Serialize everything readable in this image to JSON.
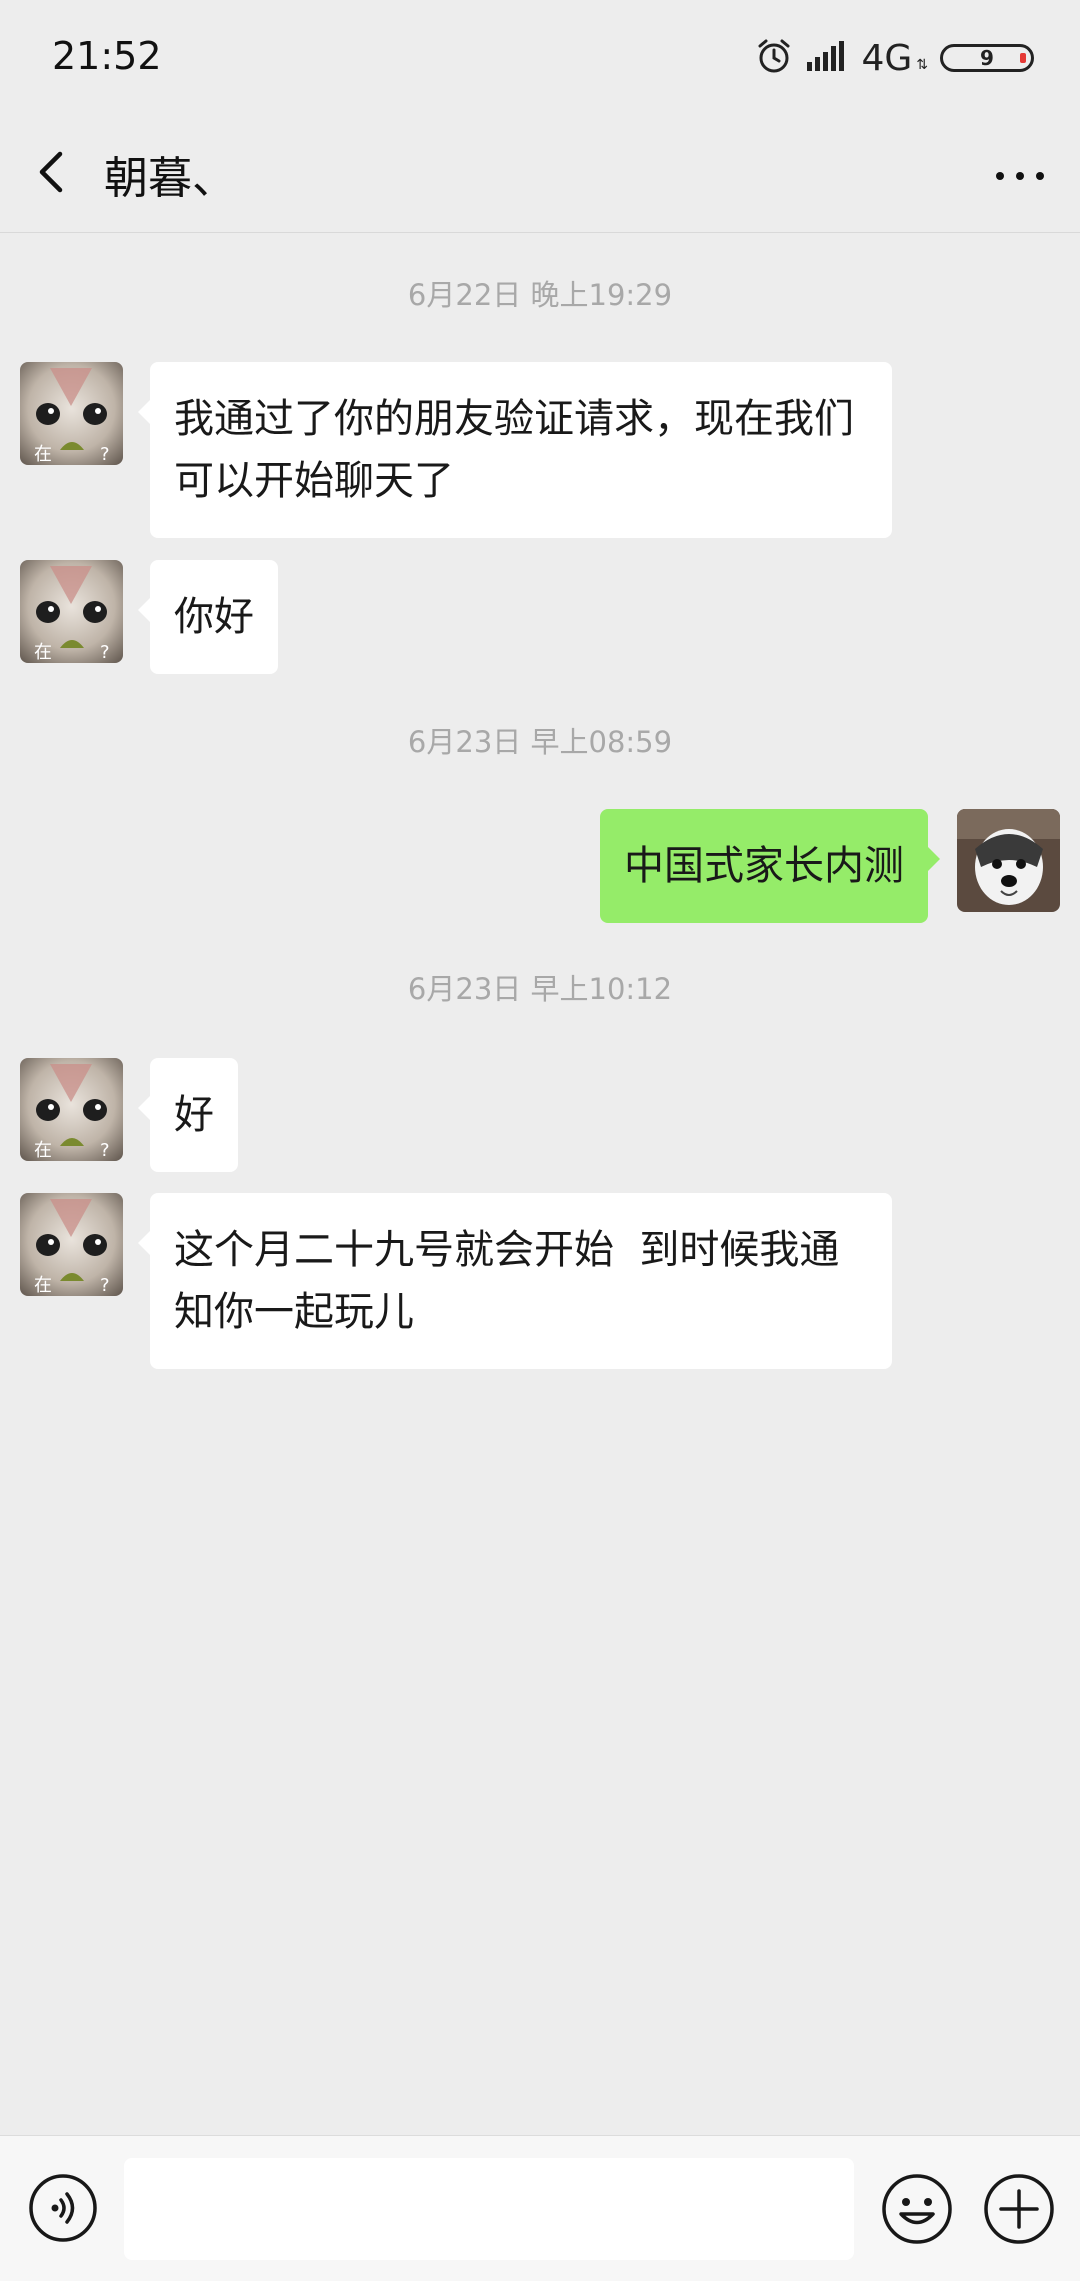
{
  "status_bar": {
    "time": "21:52",
    "network": "4G",
    "battery_level": "9",
    "icons": [
      "alarm-icon",
      "signal-icon",
      "battery-icon"
    ]
  },
  "header": {
    "title": "朝暮、",
    "icons": [
      "back-arrow-icon",
      "more-icon"
    ]
  },
  "messages": {
    "ts1": "6月22日 晚上19:29",
    "m1": "我通过了你的朋友验证请求，现在我们可以开始聊天了",
    "m2": "你好",
    "ts2": "6月23日 早上08:59",
    "m3": "中国式家长内测",
    "ts3": "6月23日 早上10:12",
    "m4": "好",
    "m5": "这个月二十九号就会开始  到时候我通知你一起玩儿"
  },
  "avatar_caption": "在  ？",
  "input_bar": {
    "placeholder": "",
    "icons": [
      "voice-icon",
      "emoji-icon",
      "plus-icon"
    ]
  },
  "colors": {
    "background": "#ededed",
    "outgoing_bubble": "#95ec69",
    "incoming_bubble": "#ffffff",
    "timestamp_text": "#a8a8a8"
  }
}
